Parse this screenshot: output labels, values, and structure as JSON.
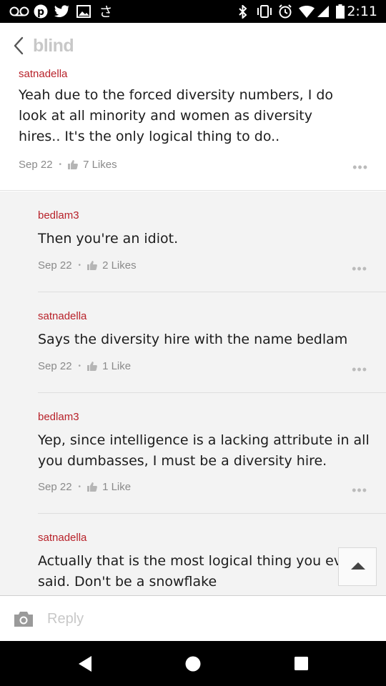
{
  "status_bar": {
    "time": "2:11",
    "left_icons": [
      "voicemail-icon",
      "pinterest-icon",
      "twitter-icon",
      "image-icon",
      "chinese-character-icon"
    ],
    "right_icons": [
      "bluetooth-icon",
      "vibrate-icon",
      "alarm-icon",
      "wifi-icon",
      "signal-icon",
      "battery-icon"
    ]
  },
  "header": {
    "logo": "blind"
  },
  "post": {
    "author": "satnadella",
    "text": "Yeah due to the forced diversity numbers, I do look at all minority and women as diversity hires.. It's the only logical thing to do..",
    "date": "Sep 22",
    "likes": "7 Likes"
  },
  "replies": [
    {
      "author": "bedlam3",
      "text": "Then you're an idiot.",
      "date": "Sep 22",
      "likes": "2 Likes"
    },
    {
      "author": "satnadella",
      "text": "Says the diversity hire with the name bedlam",
      "date": "Sep 22",
      "likes": "1 Like"
    },
    {
      "author": "bedlam3",
      "text": "Yep, since intelligence is a lacking attribute in all you dumbasses, I must be a diversity hire.",
      "date": "Sep 22",
      "likes": "1 Like"
    },
    {
      "author": "satnadella",
      "text": "Actually that is the most logical thing you ever said. Don't be a snowflake",
      "date": "",
      "likes": ""
    }
  ],
  "reply_bar": {
    "placeholder": "Reply"
  },
  "colors": {
    "author": "#b8222a",
    "reply_background": "#f3f3f3",
    "logo": "#c8c8c8"
  }
}
